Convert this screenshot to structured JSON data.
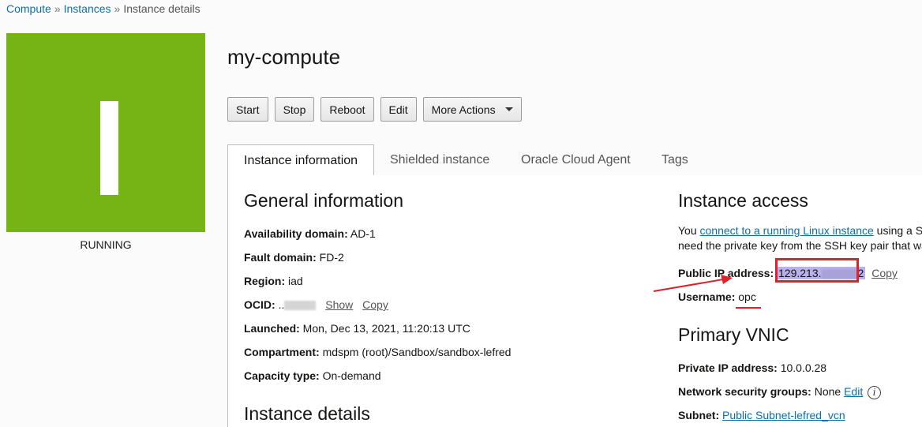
{
  "breadcrumb": {
    "items": [
      {
        "label": "Compute"
      },
      {
        "label": "Instances"
      },
      {
        "label": "Instance details"
      }
    ],
    "separator": "»"
  },
  "status": {
    "label": "RUNNING",
    "color": "#76b314",
    "icon": "instance-status-icon"
  },
  "title": "my-compute",
  "actions": {
    "start": "Start",
    "stop": "Stop",
    "reboot": "Reboot",
    "edit": "Edit",
    "more": "More Actions"
  },
  "tabs": [
    {
      "label": "Instance information",
      "active": true
    },
    {
      "label": "Shielded instance",
      "active": false
    },
    {
      "label": "Oracle Cloud Agent",
      "active": false
    },
    {
      "label": "Tags",
      "active": false
    }
  ],
  "general": {
    "title": "General information",
    "availability_domain": {
      "label": "Availability domain:",
      "value": "AD-1"
    },
    "fault_domain": {
      "label": "Fault domain:",
      "value": "FD-2"
    },
    "region": {
      "label": "Region:",
      "value": "iad"
    },
    "ocid": {
      "label": "OCID:",
      "value": "..",
      "show": "Show",
      "copy": "Copy"
    },
    "launched": {
      "label": "Launched:",
      "value": "Mon, Dec 13, 2021, 11:20:13 UTC"
    },
    "compartment": {
      "label": "Compartment:",
      "value": "mdspm (root)/Sandbox/sandbox-lefred"
    },
    "capacity_type": {
      "label": "Capacity type:",
      "value": "On-demand"
    }
  },
  "instance_details": {
    "title": "Instance details"
  },
  "access": {
    "title": "Instance access",
    "text_before": "You ",
    "link": "connect to a running Linux instance",
    "text_after": " using a S",
    "line2": "need the private key from the SSH key pair that wa",
    "public_ip": {
      "label": "Public IP address:",
      "value": "129.213.",
      "tail": "2",
      "copy": "Copy"
    },
    "username": {
      "label": "Username:",
      "value": "opc"
    }
  },
  "vnic": {
    "title": "Primary VNIC",
    "private_ip": {
      "label": "Private IP address:",
      "value": "10.0.0.28"
    },
    "nsg": {
      "label": "Network security groups:",
      "value": "None",
      "edit": "Edit"
    },
    "subnet": {
      "label": "Subnet:",
      "value": "Public Subnet-lefred_vcn"
    }
  },
  "annotation_color": "#e0202a"
}
